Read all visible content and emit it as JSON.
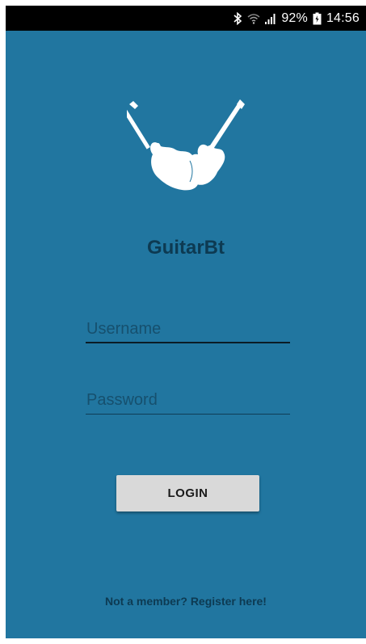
{
  "status_bar": {
    "battery": "92%",
    "time": "14:56",
    "icons": [
      "bluetooth-icon",
      "wifi-icon",
      "signal-icon",
      "battery-icon"
    ]
  },
  "app": {
    "logo_icon": "crossed-guitars-icon",
    "title": "GuitarBt"
  },
  "form": {
    "username_placeholder": "Username",
    "username_value": "",
    "password_placeholder": "Password",
    "password_value": "",
    "login_label": "LOGIN"
  },
  "footer": {
    "register_text": "Not a member? Register here!"
  },
  "colors": {
    "background": "#2176a0",
    "title": "#0d3a52",
    "button": "#d9d9d9",
    "status_bar": "#000000"
  }
}
